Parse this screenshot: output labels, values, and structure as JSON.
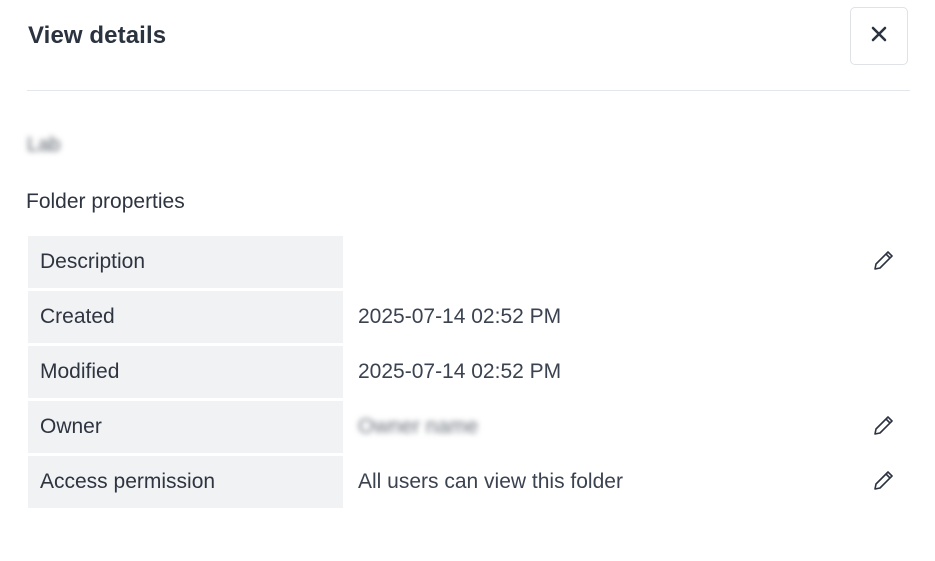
{
  "dialog": {
    "title": "View details",
    "close_icon": "close-icon"
  },
  "folder": {
    "name": "Lab"
  },
  "properties": {
    "section_title": "Folder properties",
    "rows": [
      {
        "label": "Description",
        "value": "",
        "editable": true
      },
      {
        "label": "Created",
        "value": "2025-07-14 02:52 PM",
        "editable": false
      },
      {
        "label": "Modified",
        "value": "2025-07-14 02:52 PM",
        "editable": false
      },
      {
        "label": "Owner",
        "value": "Owner name",
        "editable": true
      },
      {
        "label": "Access permission",
        "value": "All users can view this folder",
        "editable": true
      }
    ]
  },
  "colors": {
    "label_bg": "#f1f2f4",
    "divider": "#e3e6ea",
    "text": "#2e3440"
  }
}
